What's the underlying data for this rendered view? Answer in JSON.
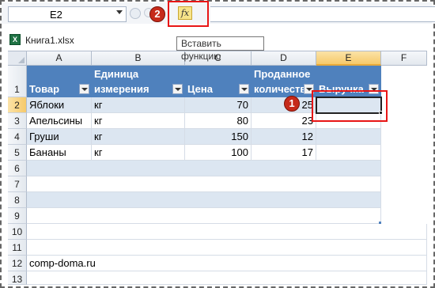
{
  "formula_bar": {
    "name_box": "E2",
    "fx_label": "fx",
    "badge_label": "2",
    "tooltip": "Вставить функцию"
  },
  "workbook": {
    "title": "Книга1.xlsx",
    "icon_label": "X"
  },
  "columns": [
    "A",
    "B",
    "C",
    "D",
    "E",
    "F"
  ],
  "selected_column": "E",
  "rows": [
    "1",
    "2",
    "3",
    "4",
    "5",
    "6",
    "7",
    "8",
    "9",
    "10",
    "11",
    "12",
    "13"
  ],
  "selected_row": "2",
  "table": {
    "headers": {
      "a": "Товар",
      "b1": "Единица",
      "b2": "измерения",
      "c": "Цена",
      "d1": "Проданное",
      "d2": "количеств",
      "e": "Выручка"
    },
    "rows": [
      {
        "product": "Яблоки",
        "unit": "кг",
        "price": "70",
        "qty": "25",
        "revenue": ""
      },
      {
        "product": "Апельсины",
        "unit": "кг",
        "price": "80",
        "qty": "23",
        "revenue": ""
      },
      {
        "product": "Груши",
        "unit": "кг",
        "price": "150",
        "qty": "12",
        "revenue": ""
      },
      {
        "product": "Бананы",
        "unit": "кг",
        "price": "100",
        "qty": "17",
        "revenue": ""
      }
    ]
  },
  "footer_cell": "comp-doma.ru",
  "cell_badge_label": "1",
  "colors": {
    "table_header": "#4f81bd",
    "band": "#dce6f1",
    "highlight": "#e81515",
    "badge": "#c62a1a"
  }
}
